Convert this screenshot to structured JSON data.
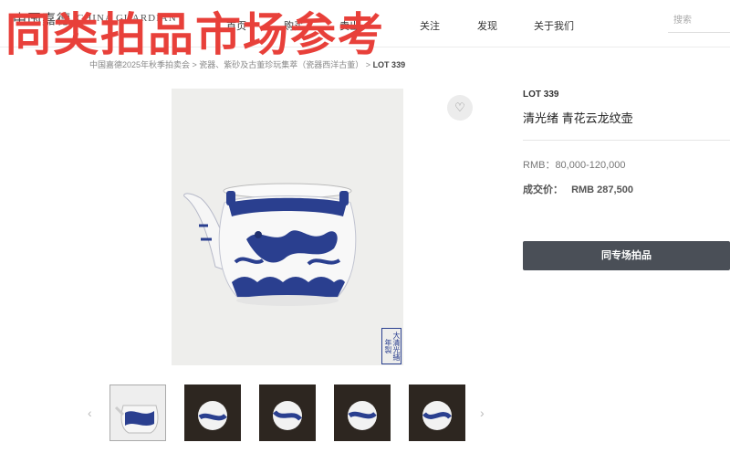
{
  "header": {
    "logo_cn": "中国嘉德",
    "logo_en": "CHINA GUARDIAN",
    "nav": [
      "首页",
      "购买",
      "卖出",
      "关注",
      "发现",
      "关于我们"
    ],
    "search_placeholder": "搜索"
  },
  "overlay_title": "同类拍品市场参考",
  "breadcrumb": {
    "path": "中国嘉德2025年秋季拍卖会 > 瓷器、紫砂及古董珍玩集萃（瓷器西洋古董） >",
    "current": "LOT 339"
  },
  "item": {
    "lot": "LOT 339",
    "title": "清光绪 青花云龙纹壶",
    "estimate": "RMB：80,000-120,000",
    "sold_label": "成交价：",
    "sold_value": "RMB 287,500",
    "seal_text": "大清光緒年製"
  },
  "buttons": {
    "same_session": "同专场拍品",
    "favorite_icon": "heart-icon",
    "prev_icon": "chevron-left-icon",
    "next_icon": "chevron-right-icon"
  },
  "colors": {
    "overlay": "#e8403a",
    "button": "#4a4f57",
    "porcelain_blue": "#2a3f8f"
  }
}
